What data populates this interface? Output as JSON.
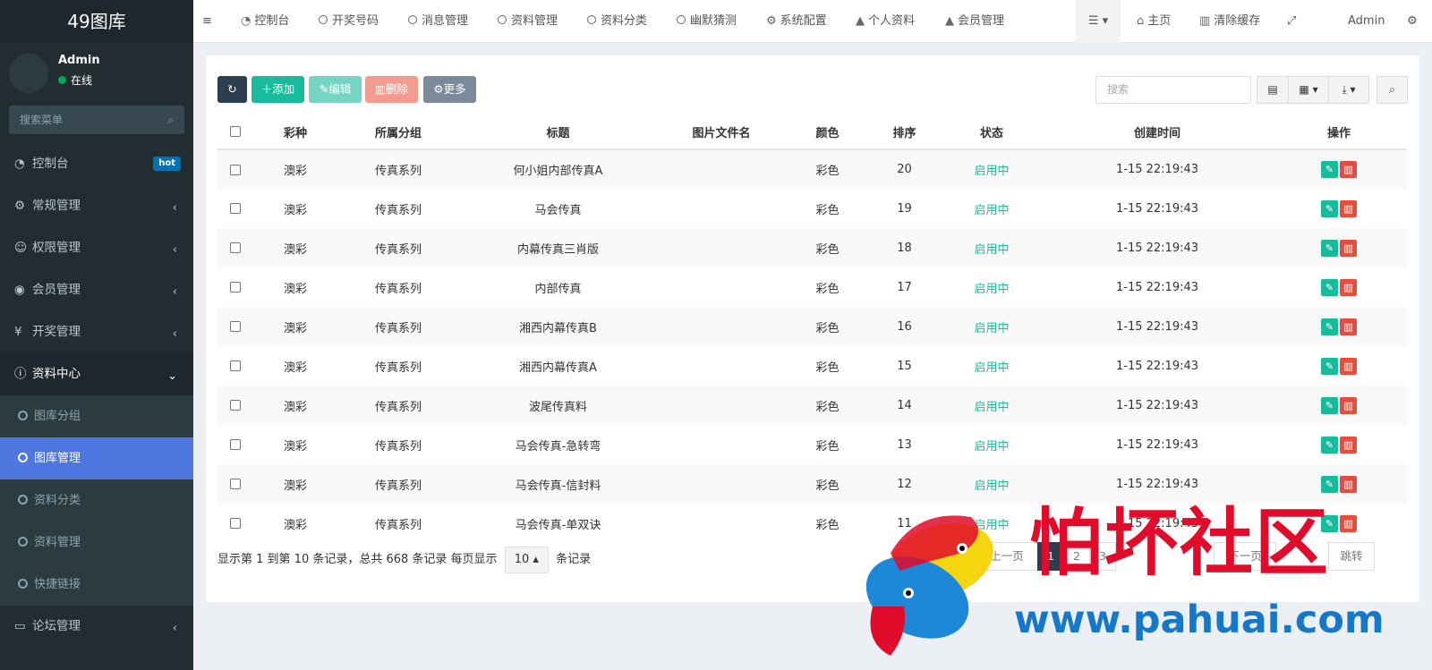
{
  "sidebar": {
    "logo": "49图库",
    "user": {
      "name": "Admin",
      "status": "在线"
    },
    "search_placeholder": "搜索菜单",
    "hot_badge": "hot",
    "menu": [
      {
        "label": "控制台",
        "icon": "dashboard-icon"
      },
      {
        "label": "常规管理",
        "icon": "cogs-icon"
      },
      {
        "label": "权限管理",
        "icon": "users-icon"
      },
      {
        "label": "会员管理",
        "icon": "user-circle-icon"
      },
      {
        "label": "开奖管理",
        "icon": "yen-icon"
      },
      {
        "label": "资料中心",
        "icon": "info-icon"
      }
    ],
    "submenu": [
      "图库分组",
      "图库管理",
      "资料分类",
      "资料管理",
      "快捷链接"
    ],
    "forum": "论坛管理"
  },
  "topnav": {
    "items": [
      "控制台",
      "开奖号码",
      "消息管理",
      "资料管理",
      "资料分类",
      "幽默猜测",
      "系统配置",
      "个人资料",
      "会员管理"
    ],
    "home": "主页",
    "clear_cache": "清除缓存",
    "user": "Admin"
  },
  "toolbar": {
    "add": "添加",
    "edit": "编辑",
    "delete": "删除",
    "more": "更多",
    "search_placeholder": "搜索"
  },
  "table": {
    "headers": [
      "彩种",
      "所属分组",
      "标题",
      "图片文件名",
      "颜色",
      "排序",
      "状态",
      "创建时间",
      "操作"
    ],
    "rows": [
      {
        "type": "澳彩",
        "group": "传真系列",
        "title": "何小姐内部传真A",
        "file": "",
        "color": "彩色",
        "sort": "20",
        "status": "启用中",
        "time": "1-15 22:19:43"
      },
      {
        "type": "澳彩",
        "group": "传真系列",
        "title": "马会传真",
        "file": "",
        "color": "彩色",
        "sort": "19",
        "status": "启用中",
        "time": "1-15 22:19:43"
      },
      {
        "type": "澳彩",
        "group": "传真系列",
        "title": "内幕传真三肖版",
        "file": "",
        "color": "彩色",
        "sort": "18",
        "status": "启用中",
        "time": "1-15 22:19:43"
      },
      {
        "type": "澳彩",
        "group": "传真系列",
        "title": "内部传真",
        "file": "",
        "color": "彩色",
        "sort": "17",
        "status": "启用中",
        "time": "1-15 22:19:43"
      },
      {
        "type": "澳彩",
        "group": "传真系列",
        "title": "湘西内幕传真B",
        "file": "",
        "color": "彩色",
        "sort": "16",
        "status": "启用中",
        "time": "1-15 22:19:43"
      },
      {
        "type": "澳彩",
        "group": "传真系列",
        "title": "湘西内幕传真A",
        "file": "",
        "color": "彩色",
        "sort": "15",
        "status": "启用中",
        "time": "1-15 22:19:43"
      },
      {
        "type": "澳彩",
        "group": "传真系列",
        "title": "波尾传真料",
        "file": "",
        "color": "彩色",
        "sort": "14",
        "status": "启用中",
        "time": "1-15 22:19:43"
      },
      {
        "type": "澳彩",
        "group": "传真系列",
        "title": "马会传真-急转弯",
        "file": "",
        "color": "彩色",
        "sort": "13",
        "status": "启用中",
        "time": "1-15 22:19:43"
      },
      {
        "type": "澳彩",
        "group": "传真系列",
        "title": "马会传真-信封料",
        "file": "",
        "color": "彩色",
        "sort": "12",
        "status": "启用中",
        "time": "1-15 22:19:43"
      },
      {
        "type": "澳彩",
        "group": "传真系列",
        "title": "马会传真-单双诀",
        "file": "",
        "color": "彩色",
        "sort": "11",
        "status": "启用中",
        "time": "1-15 22:19:43"
      }
    ]
  },
  "footer": {
    "text_before": "显示第 1 到第 10 条记录，总共 668 条记录 每页显示",
    "page_size": "10",
    "text_after": "条记录",
    "prev": "上一页",
    "pages": [
      "1",
      "2",
      "3"
    ],
    "next": "下一页",
    "jump": "跳转"
  },
  "watermark": {
    "brand": "怕坏社区",
    "url": "www.pahuai.com"
  },
  "colors": {
    "sidebar_bg": "#222d32",
    "active_item": "#4f77e0",
    "success": "#18bc9c",
    "danger": "#e74c3c"
  }
}
